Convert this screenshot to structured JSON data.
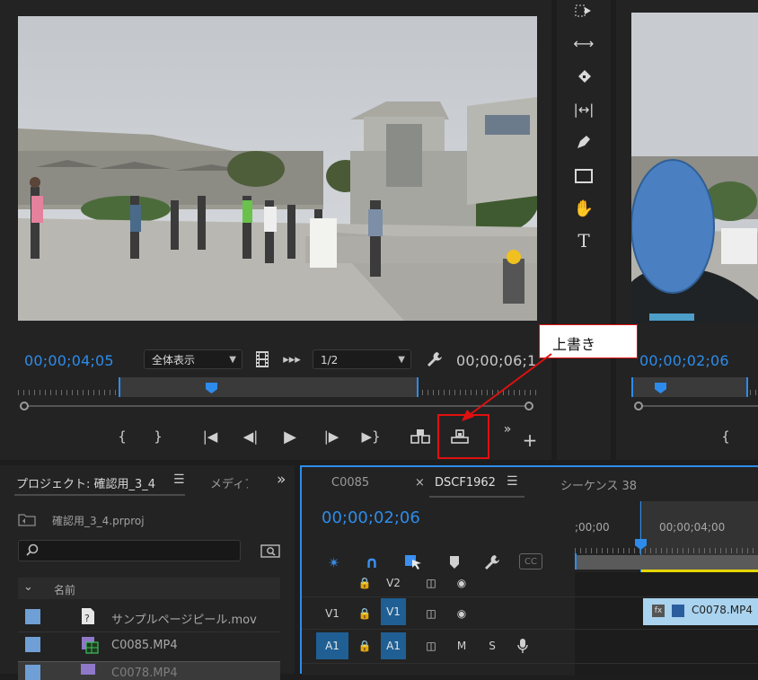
{
  "source_monitor": {
    "timecode_in": "00;00;04;05",
    "fit_dropdown": "全体表示",
    "resolution_dropdown": "1/2",
    "timecode_duration": "00;00;06;1"
  },
  "program_monitor": {
    "timecode": "00;00;02;06"
  },
  "callout": {
    "label": "上書き",
    "color": "#e01010"
  },
  "project_panel": {
    "tab_title": "プロジェクト: 確認用_3_4",
    "tab_media": "メディア",
    "project_file": "確認用_3_4.prproj",
    "search_placeholder": "",
    "column_name": "名前",
    "items": [
      {
        "name": "サンプルページピール.mov"
      },
      {
        "name": "C0085.MP4"
      },
      {
        "name": "C0078.MP4"
      }
    ]
  },
  "timeline_panel": {
    "tab_c0085": "C0085",
    "tab_dscf": "DSCF1962",
    "tab_sequence": "シーケンス 38",
    "timecode": "00;00;02;06",
    "ruler_label_start": ";00;00",
    "ruler_label_mid": "00;00;04;00",
    "tracks": {
      "v2_label": "V2",
      "v1_source": "V1",
      "v1_target": "V1",
      "a1_source": "A1",
      "a1_target": "A1",
      "mute": "M",
      "solo": "S",
      "cc": "CC"
    },
    "clip": {
      "fx": "fx",
      "name": "C0078.MP4"
    }
  },
  "colors": {
    "accent_blue": "#2d8ceb",
    "panel_bg": "#232323",
    "clip_bg": "#a9d3ee",
    "highlight_yellow": "#e5d500"
  }
}
